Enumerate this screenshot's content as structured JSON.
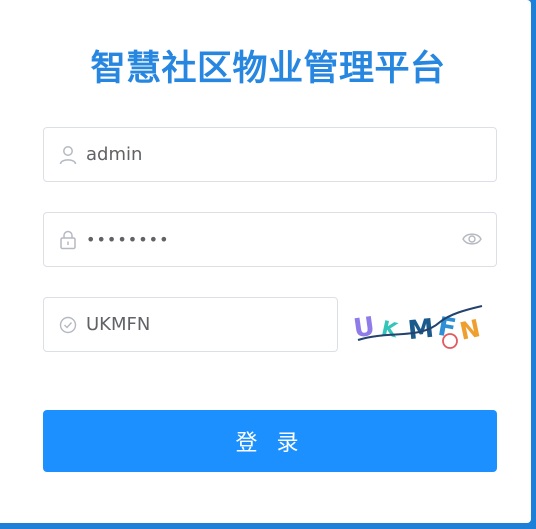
{
  "title": "智慧社区物业管理平台",
  "username": {
    "value": "admin",
    "icon": "user-icon"
  },
  "password": {
    "value": "••••••••",
    "icon": "lock-icon",
    "toggle_icon": "eye-icon"
  },
  "captcha": {
    "value": "UKMFN",
    "icon": "check-circle-icon",
    "image_text": "UKMFN"
  },
  "login_button": {
    "label": "登 录"
  },
  "colors": {
    "accent": "#1c90fe",
    "title": "#2787e0",
    "background": "#1c7fd8"
  }
}
